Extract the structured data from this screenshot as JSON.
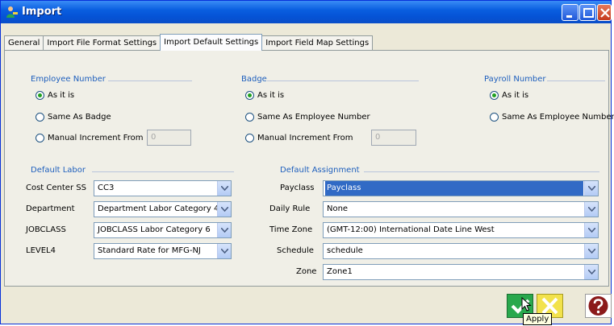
{
  "window": {
    "title": "Import"
  },
  "tabs": [
    {
      "label": "General"
    },
    {
      "label": "Import File Format Settings"
    },
    {
      "label": "Import Default Settings"
    },
    {
      "label": "Import Field Map Settings"
    }
  ],
  "employee_number": {
    "title": "Employee Number",
    "options": [
      "As it is",
      "Same As Badge",
      "Manual Increment From"
    ],
    "selected": "As it is",
    "increment_value": "0"
  },
  "badge": {
    "title": "Badge",
    "options": [
      "As it is",
      "Same As Employee Number",
      "Manual Increment From"
    ],
    "selected": "As it is",
    "increment_value": "0"
  },
  "payroll_number": {
    "title": "Payroll Number",
    "options": [
      "As it is",
      "Same As Employee Number"
    ],
    "selected": "As it is"
  },
  "default_labor": {
    "title": "Default Labor",
    "rows": [
      {
        "label": "Cost Center SS",
        "value": "CC3"
      },
      {
        "label": "Department",
        "value": "Department Labor Category 4"
      },
      {
        "label": "JOBCLASS",
        "value": "JOBCLASS Labor Category 6"
      },
      {
        "label": "LEVEL4",
        "value": "Standard Rate for MFG-NJ"
      }
    ]
  },
  "default_assignment": {
    "title": "Default Assignment",
    "rows": [
      {
        "label": "Payclass",
        "value": "Payclass"
      },
      {
        "label": "Daily Rule",
        "value": "None"
      },
      {
        "label": "Time Zone",
        "value": "(GMT-12:00) International Date Line West"
      },
      {
        "label": "Schedule",
        "value": "schedule"
      },
      {
        "label": "Zone",
        "value": "Zone1"
      }
    ]
  },
  "footer": {
    "tooltip": "Apply"
  },
  "icons": {
    "app": "import-app-icon",
    "ok": "checkmark-icon",
    "cancel": "x-icon",
    "help": "question-icon"
  },
  "colors": {
    "titlebar": "#0a5fe0",
    "group_label": "#1e5fbd",
    "selection": "#316ac5",
    "ok": "#29a84d",
    "cancel": "#f2e24c",
    "help": "#8b1a1a"
  }
}
